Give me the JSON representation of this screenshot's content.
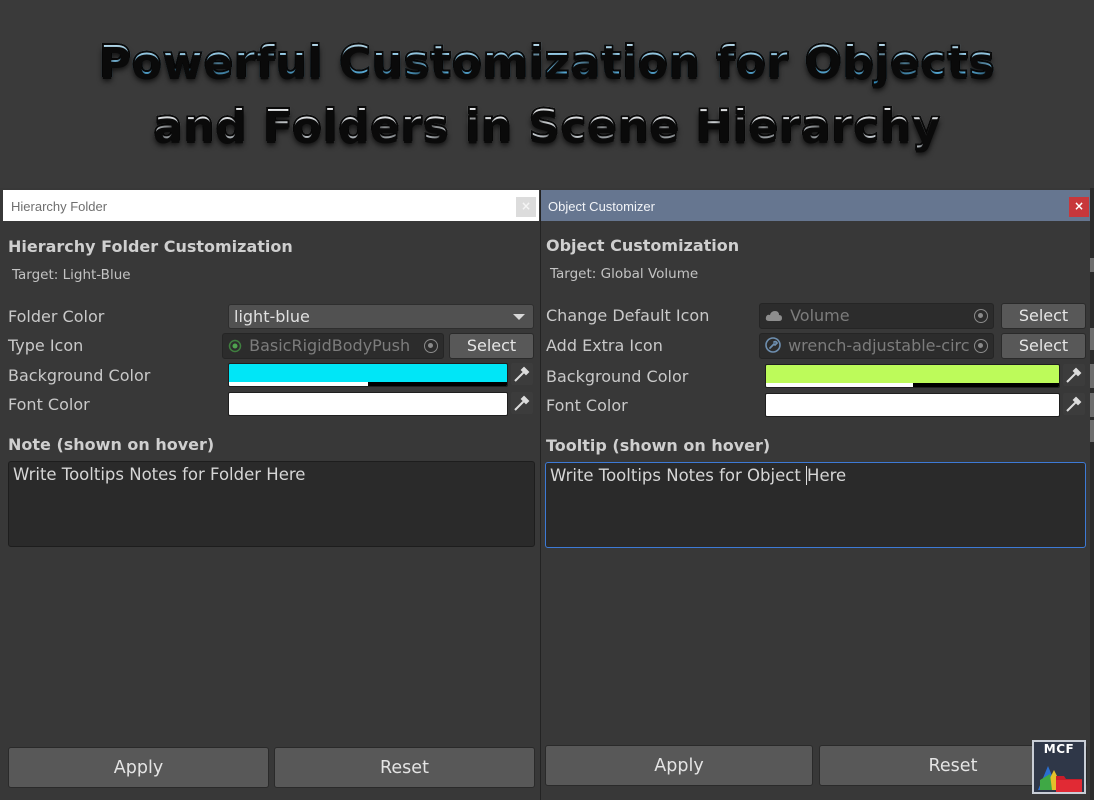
{
  "banner": {
    "line1": "Powerful Customization for Objects",
    "line2": "and Folders in Scene Hierarchy"
  },
  "folder_window": {
    "title": "Hierarchy Folder",
    "heading": "Hierarchy Folder Customization",
    "target": "Target: Light-Blue",
    "folder_color_label": "Folder Color",
    "folder_color_value": "light-blue",
    "type_icon_label": "Type Icon",
    "type_icon_value": "BasicRigidBodyPush",
    "select_label": "Select",
    "background_color_label": "Background Color",
    "background_color": "#00e6f7",
    "background_alpha": 0.5,
    "font_color_label": "Font Color",
    "font_color": "#ffffff",
    "note_label": "Note (shown on hover)",
    "note_text": "Write Tooltips Notes  for Folder Here",
    "apply_label": "Apply",
    "reset_label": "Reset"
  },
  "object_window": {
    "title": "Object Customizer",
    "close_label": "×",
    "heading": "Object Customization",
    "target": "Target: Global Volume",
    "default_icon_label": "Change Default Icon",
    "default_icon_value": "Volume",
    "extra_icon_label": "Add Extra Icon",
    "extra_icon_value": "wrench-adjustable-circ",
    "select_label": "Select",
    "background_color_label": "Background Color",
    "background_color": "#bdfb5a",
    "background_alpha": 0.5,
    "font_color_label": "Font Color",
    "font_color": "#ffffff",
    "tooltip_label": "Tooltip (shown on hover)",
    "tooltip_text_before_caret": "Write Tooltips Notes  for Object ",
    "tooltip_text_after_caret": "Here",
    "apply_label": "Apply",
    "reset_label": "Reset"
  },
  "logo": {
    "text": "MCF"
  }
}
